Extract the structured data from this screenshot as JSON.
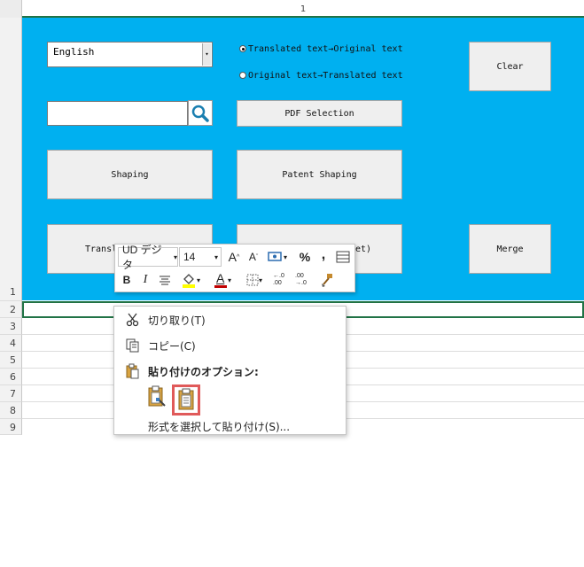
{
  "sheet": {
    "column_label": "1",
    "rows": [
      "1",
      "2",
      "3",
      "4",
      "5",
      "6",
      "7",
      "8",
      "9"
    ]
  },
  "controls": {
    "language_value": "English",
    "radio_translated_to_original": "Translated text→Original text",
    "radio_original_to_translated": "Original text→Translated text",
    "clear": "Clear",
    "pdf_selection": "PDF Selection",
    "shaping": "Shaping",
    "patent_shaping": "Patent Shaping",
    "translate_partial": "Transl",
    "sheet_partial": "et)",
    "merge": "Merge"
  },
  "mini_toolbar": {
    "font_name": "UD デジタ",
    "font_size": "14",
    "bold": "B",
    "italic": "I",
    "font_color_letter": "A",
    "percent": "%",
    "comma": ",",
    "increase_decimal": "←.0 .00",
    "decrease_decimal": ".00 →.0",
    "accent_fill": "#ffff00",
    "accent_font": "#c00000"
  },
  "context_menu": {
    "cut": "切り取り(T)",
    "copy": "コピー(C)",
    "paste_options_heading": "貼り付けのオプション:",
    "paste_special": "形式を選択して貼り付け(S)...",
    "highlight_color": "#e05a5a"
  }
}
